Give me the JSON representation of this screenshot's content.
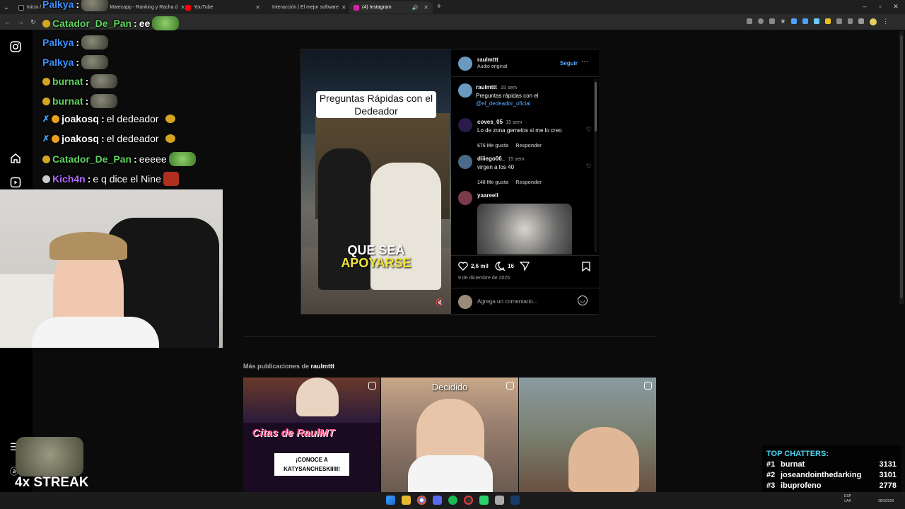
{
  "tabs": [
    {
      "label": "Inicio / X",
      "color": "#000000"
    },
    {
      "label": "Matecapp - Ranking y Racha d",
      "color": "#3b7a3b"
    },
    {
      "label": "YouTube",
      "color": "#ff0000"
    },
    {
      "label": "Interacción | El mejor software",
      "color": "#666666"
    },
    {
      "label": "(4) Instagram",
      "color": "#d6249f"
    }
  ],
  "chat": [
    {
      "user": "Palkya",
      "msg": "",
      "color": "#3d8fff"
    },
    {
      "user": "Catador_De_Pan",
      "msg": "ee",
      "color": "#5fd35f"
    },
    {
      "user": "Palkya",
      "msg": "",
      "color": "#3d8fff"
    },
    {
      "user": "Palkya",
      "msg": "",
      "color": "#3d8fff"
    },
    {
      "user": "burnat",
      "msg": "",
      "color": "#5fd35f"
    },
    {
      "user": "burnat",
      "msg": "",
      "color": "#5fd35f"
    },
    {
      "user": "joakosq",
      "msg": "el dedeador",
      "color": "#ffffff"
    },
    {
      "user": "joakosq",
      "msg": "el dedeador",
      "color": "#ffffff"
    },
    {
      "user": "Catador_De_Pan",
      "msg": "eeeee",
      "color": "#5fd35f"
    },
    {
      "user": "Kich4n",
      "msg": "e q dice el Nine",
      "color": "#b36bff"
    }
  ],
  "post": {
    "author": "raulmttt",
    "audio": "Audio original",
    "follow": "Seguir",
    "more": "···",
    "caption_time": "15 sem",
    "caption_line1": "Preguntas rápidas con el",
    "caption_mention": "@el_dedeador_oficial",
    "video_title": "Preguntas Rápidas con el Dedeador",
    "video_sub1": "QUE SEA",
    "video_sub2": "APOYARSE",
    "comments": [
      {
        "user": "coves_05",
        "time": "15 sem",
        "text": "Lo de zona gemelos si me lo creo",
        "likes": "676 Me gusta",
        "reply": "Responder",
        "avatar": "#3a1a5a"
      },
      {
        "user": "diiiego06_",
        "time": "15 sem",
        "text": "virgen a los 40",
        "likes": "148 Me gusta",
        "reply": "Responder",
        "avatar": "#4a6a8a"
      },
      {
        "user": "yaareell",
        "time": "",
        "text": "",
        "likes": "",
        "reply": "",
        "avatar": "#7a3a4a"
      }
    ],
    "like_count": "2,6 mil",
    "comment_count": "16",
    "date": "9 de diciembre de 2025",
    "add_comment_placeholder": "Agrega un comentario..."
  },
  "more_posts": {
    "prefix": "Más publicaciones de",
    "author": "raulmttt",
    "thumbs": [
      {
        "caption": "¡CONOCE A KATYSANCHESKIIIII!",
        "title": "Citas de RaulMT"
      },
      {
        "caption": "Decidido"
      },
      {
        "caption": ""
      }
    ]
  },
  "streak": "4x STREAK",
  "top_chatters": {
    "title": "TOP CHATTERS:",
    "rows": [
      {
        "rank": "#1",
        "name": "burnat",
        "count": "3131"
      },
      {
        "rank": "#2",
        "name": "joseandointhedarking",
        "count": "3101"
      },
      {
        "rank": "#3",
        "name": "ibuprofeno",
        "count": "2778"
      }
    ]
  },
  "tray": {
    "lang": "ESP",
    "lang2": "LAA",
    "date": "28/3/2026"
  }
}
